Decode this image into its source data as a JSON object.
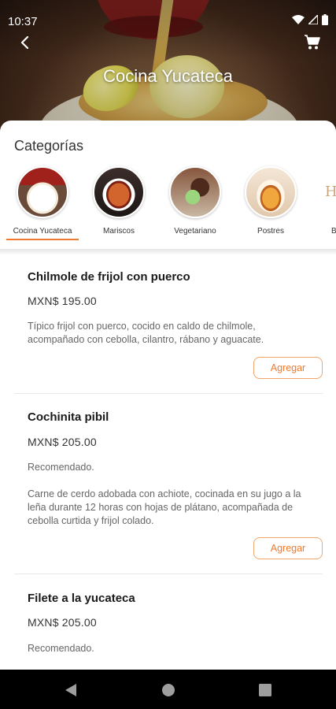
{
  "status": {
    "time": "10:37"
  },
  "header": {
    "title": "Cocina Yucateca"
  },
  "categories": {
    "title": "Categorías",
    "items": [
      {
        "label": "Cocina Yucateca",
        "selected": true
      },
      {
        "label": "Mariscos",
        "selected": false
      },
      {
        "label": "Vegetariano",
        "selected": false
      },
      {
        "label": "Postres",
        "selected": false
      },
      {
        "label": "B",
        "selected": false
      }
    ]
  },
  "menu": {
    "add_label": "Agregar",
    "items": [
      {
        "name": "Chilmole de frijol con puerco",
        "price": "MXN$ 195.00",
        "note": "",
        "description": "Típico frijol con puerco, cocido en caldo de chilmole, acompañado con cebolla, cilantro, rábano y aguacate."
      },
      {
        "name": "Cochinita pibil",
        "price": "MXN$ 205.00",
        "note": "Recomendado.",
        "description": "Carne de cerdo adobada con achiote, cocinada en su jugo a la leña durante 12 horas con hojas de plátano, acompañada de cebolla curtida y frijol colado."
      },
      {
        "name": "Filete a la yucateca",
        "price": "MXN$ 205.00",
        "note": "Recomendado.",
        "description": ""
      }
    ]
  },
  "colors": {
    "accent": "#f07a2e",
    "accent_border": "#f3a468"
  },
  "icons": {
    "back": "arrow-back-icon",
    "cart": "shopping-cart-icon",
    "wifi": "wifi-icon",
    "signal": "signal-icon",
    "battery": "battery-icon",
    "nav_back": "nav-back-icon",
    "nav_home": "nav-home-icon",
    "nav_recents": "nav-recents-icon"
  }
}
